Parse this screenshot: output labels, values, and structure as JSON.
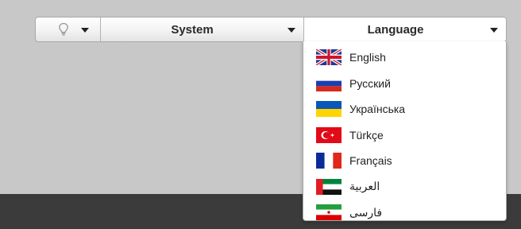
{
  "menubar": {
    "hint_icon": "lightbulb-icon",
    "system_label": "System",
    "language_label": "Language"
  },
  "languages": [
    {
      "label": "English",
      "flag": "uk-flag-icon"
    },
    {
      "label": "Русский",
      "flag": "russia-flag-icon"
    },
    {
      "label": "Українська",
      "flag": "ukraine-flag-icon"
    },
    {
      "label": "Türkçe",
      "flag": "turkey-flag-icon"
    },
    {
      "label": "Français",
      "flag": "france-flag-icon"
    },
    {
      "label": "العربية",
      "flag": "uae-flag-icon"
    },
    {
      "label": "فارسی",
      "flag": "iran-flag-icon"
    }
  ],
  "colors": {
    "background": "#c8c8c8",
    "footer": "#3b3b3b"
  }
}
